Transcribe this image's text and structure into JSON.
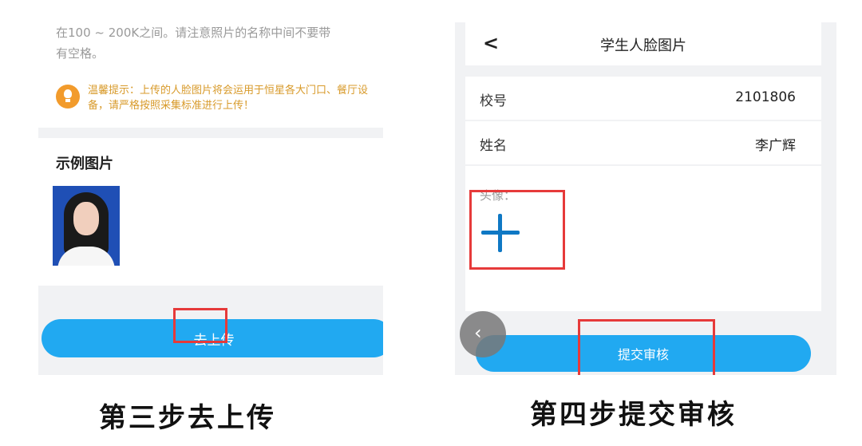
{
  "left": {
    "cut_text": "在100 ~ 200K之间。请注意照片的名称中间不要带",
    "cut_text_line2": "有空格。",
    "tip_text": "温馨提示：上传的人脸图片将会运用于恒星各大门口、餐厅设备，请严格按照采集标准进行上传！",
    "example_title": "示例图片",
    "upload_button": "去上传",
    "caption": "第三步去上传"
  },
  "right": {
    "back_glyph": "<",
    "title": "学生人脸图片",
    "fields": [
      {
        "label": "校号",
        "value": "2101806"
      },
      {
        "label": "姓名",
        "value": "李广辉"
      }
    ],
    "photo_label": "头像：",
    "submit_button": "提交审核",
    "float_back_glyph": "‹",
    "caption": "第四步提交审核"
  },
  "colors": {
    "accent": "#21a9f1",
    "highlight": "#e63a3a",
    "tip": "#d89a2a",
    "plus": "#0f78c4"
  }
}
